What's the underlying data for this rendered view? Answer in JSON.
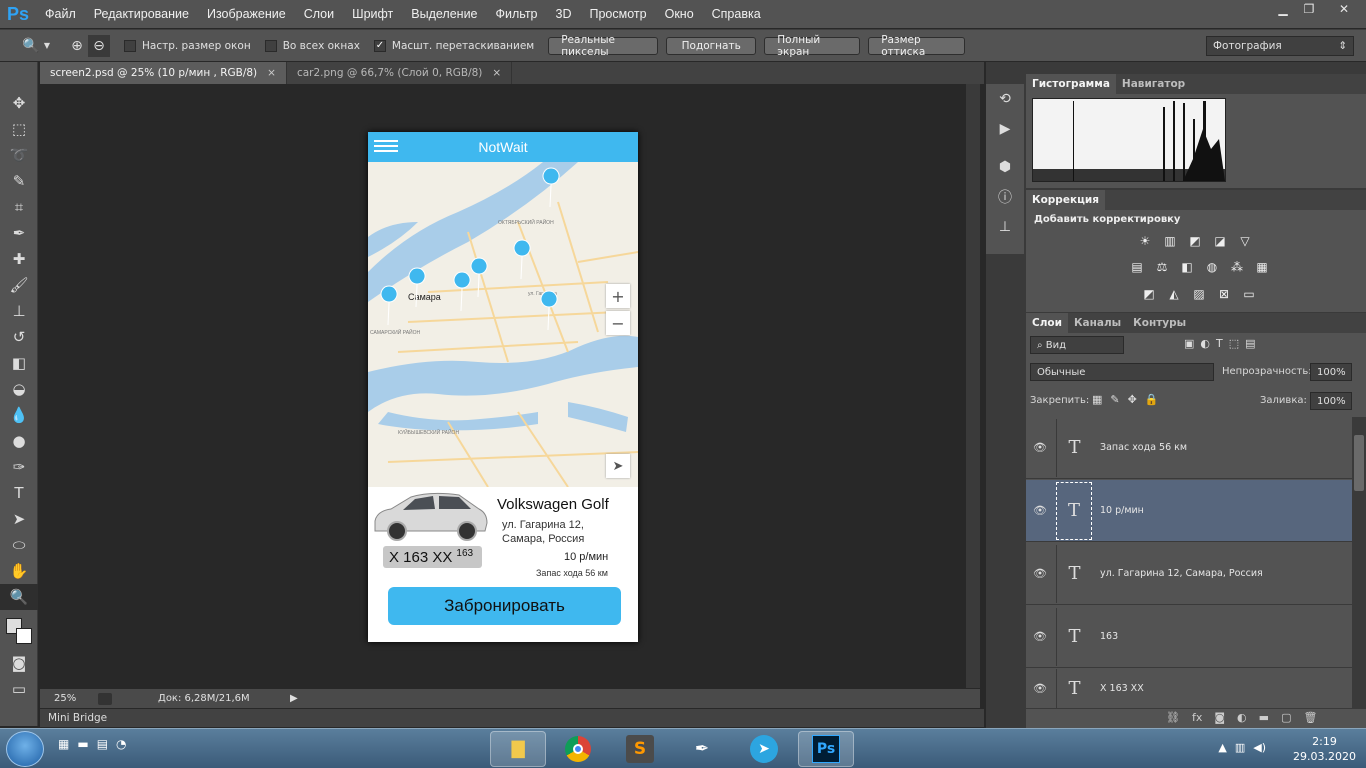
{
  "app": {
    "logo": "Ps",
    "title": "Adobe Photoshop"
  },
  "menu": [
    "Файл",
    "Редактирование",
    "Изображение",
    "Слои",
    "Шрифт",
    "Выделение",
    "Фильтр",
    "3D",
    "Просмотр",
    "Окно",
    "Справка"
  ],
  "options": {
    "chk_resize": "Настр. размер окон",
    "chk_all": "Во всех окнах",
    "chk_scrubby": "Масшт. перетаскиванием",
    "btn_actual": "Реальные пикселы",
    "btn_fit": "Подогнать",
    "btn_full": "Полный экран",
    "btn_print": "Размер оттиска",
    "preset": "Фотография"
  },
  "doc_tabs": [
    {
      "label": "screen2.psd @ 25% (10 р/мин , RGB/8)"
    },
    {
      "label": "car2.png @ 66,7% (Слой 0, RGB/8)"
    }
  ],
  "status": {
    "zoom": "25%",
    "doc": "Док: 6,28M/21,6M"
  },
  "mini_bridge": "Mini Bridge",
  "phone": {
    "app_title": "NotWait",
    "map_labels": {
      "city": "Самара",
      "district1": "ОКТЯБРЬСКИЙ РАЙОН",
      "district2": "САМАРСКИЙ РАЙОН",
      "district3": "КУЙБЫШЕВСКИЙ РАЙОН",
      "street": "ул. Гагарина",
      "zoom_in": "+",
      "zoom_out": "−"
    },
    "car_name": "Volkswagen Golf",
    "address": "ул. Гагарина 12, Самара, Россия",
    "plate": "Х 163 ХХ",
    "plate_region": "163",
    "price": "10 р/мин",
    "range": "Запас хода 56 км",
    "book_label": "Забронировать"
  },
  "panels": {
    "histogram_tab": "Гистограмма",
    "navigator_tab": "Навигатор",
    "correction_tab": "Коррекция",
    "add_adjustment": "Добавить корректировку",
    "layers_tab": "Слои",
    "channels_tab": "Каналы",
    "paths_tab": "Контуры",
    "filter_kind": "Вид",
    "blend_mode": "Обычные",
    "opacity_label": "Непрозрачность:",
    "opacity_value": "100%",
    "lock_label": "Закрепить:",
    "fill_label": "Заливка:",
    "fill_value": "100%"
  },
  "layers": [
    {
      "name": "Запас хода 56 км",
      "selected": false
    },
    {
      "name": "10 р/мин",
      "selected": true
    },
    {
      "name": "ул. Гагарина 12, Самара, Россия",
      "selected": false
    },
    {
      "name": "163",
      "selected": false
    },
    {
      "name": "Х 163 ХХ",
      "selected": false
    }
  ],
  "taskbar": {
    "time": "2:19",
    "date": "29.03.2020"
  },
  "colors": {
    "accent": "#3fb8ef",
    "ps_bg": "#535353",
    "selected_layer": "#57667d"
  }
}
